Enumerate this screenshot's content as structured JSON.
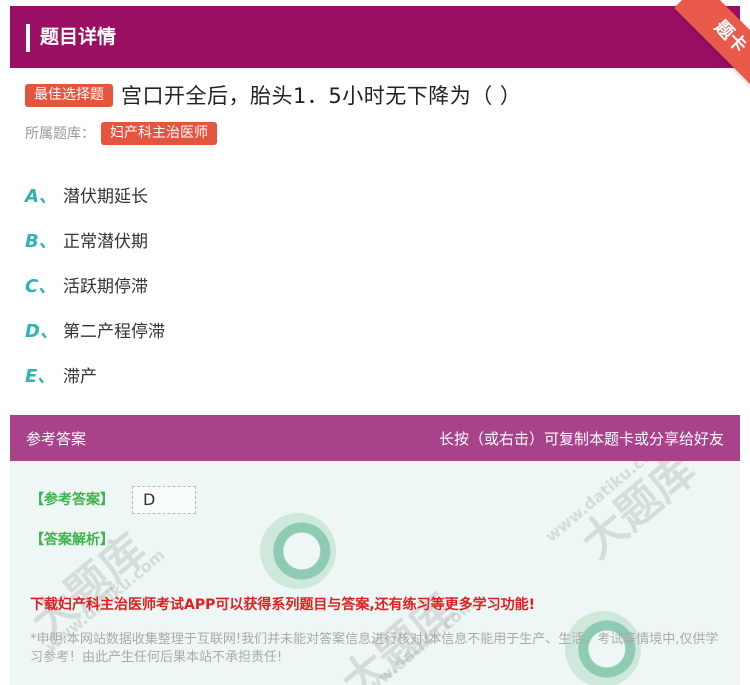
{
  "header": {
    "title": "题目详情",
    "ribbon": "题卡"
  },
  "question": {
    "type_tag": "最佳选择题",
    "text": "宫口开全后，胎头1．5小时无下降为（ ）",
    "bank_label": "所属题库：",
    "bank_name": "妇产科主治医师"
  },
  "options": [
    {
      "letter": "A、",
      "text": "潜伏期延长"
    },
    {
      "letter": "B、",
      "text": "正常潜伏期"
    },
    {
      "letter": "C、",
      "text": "活跃期停滞"
    },
    {
      "letter": "D、",
      "text": "第二产程停滞"
    },
    {
      "letter": "E、",
      "text": "滞产"
    }
  ],
  "answer_section": {
    "title": "参考答案",
    "hint": "长按（或右击）可复制本题卡或分享给好友",
    "answer_label": "【参考答案】",
    "answer_value": "D",
    "analysis_label": "【答案解析】",
    "promo": "下载妇产科主治医师考试APP可以获得系列题目与答案,还有练习等更多学习功能!",
    "disclaimer": "*申明:本网站数据收集整理于互联网!我们并未能对答案信息进行核对!本信息不能用于生产、生活、考试等情境中,仅供学习参考！由此产生任何后果本站不承担责任!",
    "watermark": "大题库",
    "watermark_url": "www.datiku.com"
  },
  "colors": {
    "header_bg": "#9a0f63",
    "ribbon": "#ea5a4a",
    "tag": "#e4543f",
    "option_letter": "#2fb4b6",
    "answer_header": "#a8428a",
    "answer_body": "#eef7f6",
    "answer_label": "#3cb54a",
    "promo": "#e02020"
  }
}
